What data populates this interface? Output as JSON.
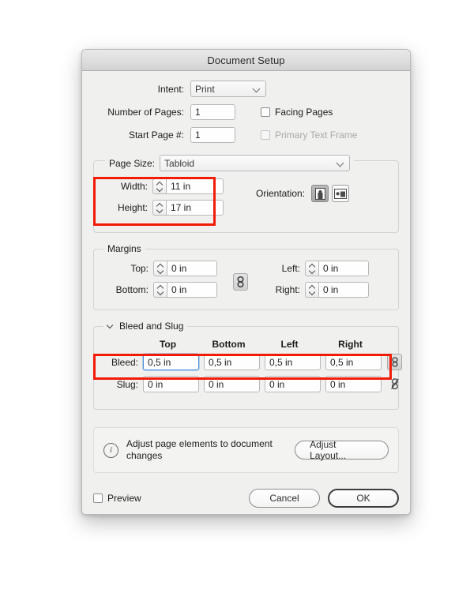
{
  "dialog": {
    "title": "Document Setup"
  },
  "intent": {
    "label": "Intent:",
    "value": "Print",
    "icon": "chevron-down-icon"
  },
  "pages": {
    "number_label": "Number of Pages:",
    "number_value": "1",
    "start_label": "Start Page #:",
    "start_value": "1",
    "facing_pages_label": "Facing Pages",
    "facing_pages_checked": false,
    "primary_text_frame_label": "Primary Text Frame",
    "primary_text_frame_checked": false,
    "primary_text_frame_disabled": true
  },
  "page_size": {
    "label": "Page Size:",
    "value": "Tabloid",
    "width_label": "Width:",
    "width_value": "11 in",
    "height_label": "Height:",
    "height_value": "17 in",
    "orientation_label": "Orientation:",
    "orientation_selected": "portrait",
    "portrait_icon": "portrait-orientation-icon",
    "landscape_icon": "landscape-orientation-icon"
  },
  "margins": {
    "legend": "Margins",
    "top_label": "Top:",
    "top_value": "0 in",
    "bottom_label": "Bottom:",
    "bottom_value": "0 in",
    "left_label": "Left:",
    "left_value": "0 in",
    "right_label": "Right:",
    "right_value": "0 in",
    "link_icon": "chain-link-icon",
    "linked": true
  },
  "bleed_slug": {
    "legend": "Bleed and Slug",
    "expanded": true,
    "disclosure_icon": "chevron-down-icon",
    "columns": [
      "Top",
      "Bottom",
      "Left",
      "Right"
    ],
    "rows": [
      {
        "label": "Bleed:",
        "values": [
          "0,5 in",
          "0,5 in",
          "0,5 in",
          "0,5 in"
        ],
        "focused_index": 0,
        "link_icon": "chain-link-icon",
        "linked": true
      },
      {
        "label": "Slug:",
        "values": [
          "0 in",
          "0 in",
          "0 in",
          "0 in"
        ],
        "focused_index": -1,
        "link_icon": "chain-link-broken-icon",
        "linked": false
      }
    ]
  },
  "adjust": {
    "info_icon": "info-circle-icon",
    "text": "Adjust page elements to document changes",
    "button_label": "Adjust Layout..."
  },
  "footer": {
    "preview_label": "Preview",
    "preview_checked": false,
    "cancel_label": "Cancel",
    "ok_label": "OK"
  },
  "annotations": {
    "accent_color": "#f21b06",
    "boxes": [
      "page-size-dimensions",
      "bleed-row"
    ]
  }
}
